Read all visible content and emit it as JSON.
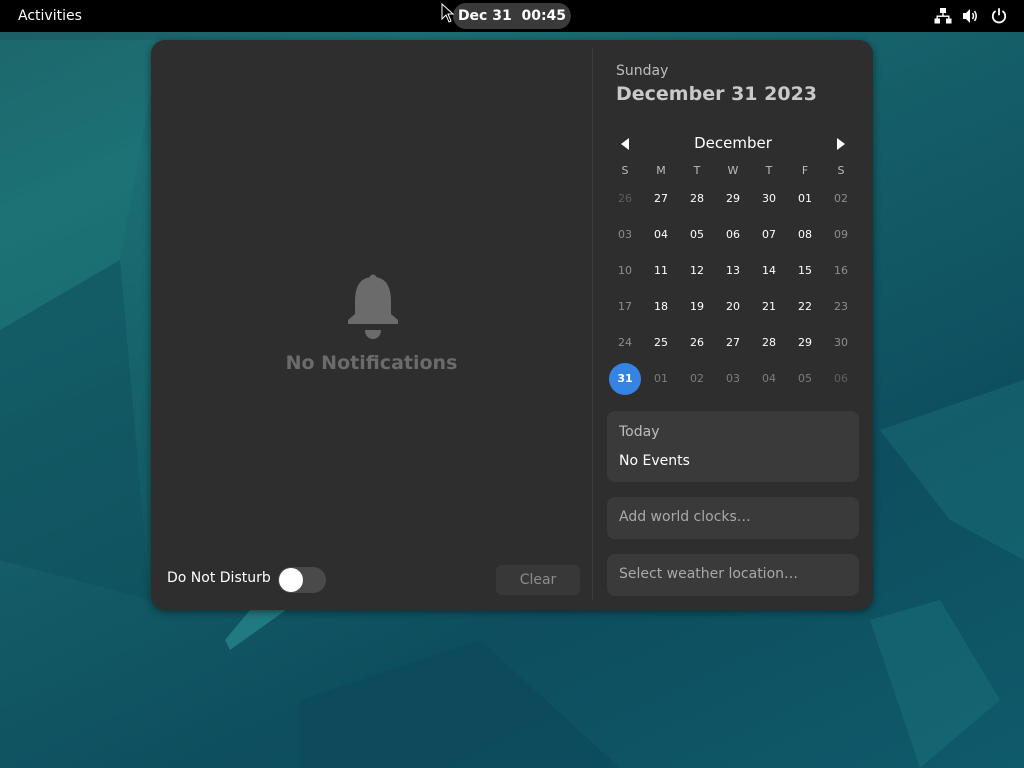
{
  "topbar": {
    "activities_label": "Activities",
    "clock_date": "Dec 31",
    "clock_time": "00:45",
    "icons": [
      "network-icon",
      "volume-icon",
      "power-icon"
    ]
  },
  "notifications": {
    "empty_icon": "bell-icon",
    "empty_text": "No Notifications",
    "dnd_label": "Do Not Disturb",
    "dnd_enabled": false,
    "clear_label": "Clear"
  },
  "calendar": {
    "weekday": "Sunday",
    "full_date": "December 31 2023",
    "month": "December",
    "day_headers": [
      "S",
      "M",
      "T",
      "W",
      "T",
      "F",
      "S"
    ],
    "weeks": [
      [
        "26",
        "27",
        "28",
        "29",
        "30",
        "01",
        "02"
      ],
      [
        "03",
        "04",
        "05",
        "06",
        "07",
        "08",
        "09"
      ],
      [
        "10",
        "11",
        "12",
        "13",
        "14",
        "15",
        "16"
      ],
      [
        "17",
        "18",
        "19",
        "20",
        "21",
        "22",
        "23"
      ],
      [
        "24",
        "25",
        "26",
        "27",
        "28",
        "29",
        "30"
      ],
      [
        "31",
        "01",
        "02",
        "03",
        "04",
        "05",
        "06"
      ]
    ],
    "selected_day": "31"
  },
  "events": {
    "heading": "Today",
    "text": "No Events"
  },
  "world_clocks_label": "Add world clocks…",
  "weather_label": "Select weather location…",
  "colors": {
    "accent": "#3584e4",
    "panel": "#2e2e2e",
    "card": "#3a3a3a",
    "topbar": "#000000"
  }
}
